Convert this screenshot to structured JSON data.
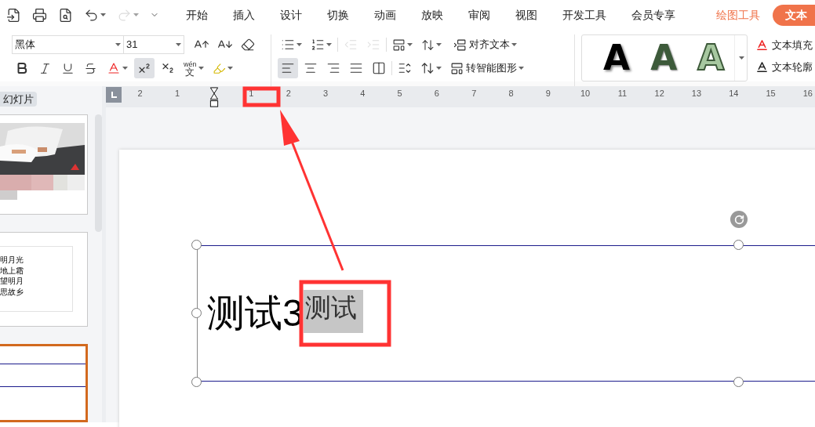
{
  "quick_access": [
    {
      "kind": "save",
      "disabled": false
    },
    {
      "kind": "print",
      "disabled": false
    },
    {
      "kind": "preview",
      "disabled": false
    },
    {
      "kind": "undo",
      "disabled": false
    },
    {
      "kind": "redo",
      "disabled": true
    },
    {
      "kind": "customize",
      "disabled": false
    }
  ],
  "tabs": [
    {
      "label": "开始",
      "kind": "normal",
      "selected": false
    },
    {
      "label": "插入",
      "kind": "normal",
      "selected": false
    },
    {
      "label": "设计",
      "kind": "normal",
      "selected": false
    },
    {
      "label": "切换",
      "kind": "normal",
      "selected": false
    },
    {
      "label": "动画",
      "kind": "normal",
      "selected": false
    },
    {
      "label": "放映",
      "kind": "normal",
      "selected": false
    },
    {
      "label": "审阅",
      "kind": "normal",
      "selected": false
    },
    {
      "label": "视图",
      "kind": "normal",
      "selected": false
    },
    {
      "label": "开发工具",
      "kind": "normal",
      "selected": false
    },
    {
      "label": "会员专享",
      "kind": "normal",
      "selected": false
    },
    {
      "label": "绘图工具",
      "kind": "context",
      "selected": false
    },
    {
      "label": "文本",
      "kind": "context",
      "selected": true
    }
  ],
  "font": {
    "name": "黑体",
    "size": "31"
  },
  "script_buttons": [
    {
      "kind": "superscript",
      "selected": true
    },
    {
      "kind": "subscript",
      "selected": false
    }
  ],
  "indent_buttons": [
    {
      "kind": "decrease",
      "disabled": true
    },
    {
      "kind": "increase",
      "disabled": true
    }
  ],
  "alignment": [
    {
      "kind": "left",
      "selected": true
    },
    {
      "kind": "center",
      "selected": false
    },
    {
      "kind": "right",
      "selected": false
    },
    {
      "kind": "justify",
      "selected": false
    },
    {
      "kind": "distributed",
      "selected": false
    }
  ],
  "pinyin": {
    "top": "wén",
    "bottom": "文"
  },
  "align_text_button": "对齐文本",
  "smartart_button": "转智能图形",
  "text_styles": [
    {
      "text": "A",
      "kind": "black"
    },
    {
      "text": "A",
      "kind": "green"
    },
    {
      "text": "A",
      "kind": "outline"
    }
  ],
  "text_fill": "文本填充",
  "text_outline": "文本轮廓",
  "ruler": {
    "left_labels": [
      "2",
      "1"
    ],
    "right_labels": [
      "1",
      "2",
      "3",
      "4",
      "5",
      "6",
      "7",
      "8",
      "9",
      "10",
      "11",
      "12",
      "13",
      "14",
      "15",
      "16"
    ]
  },
  "left_panel": {
    "tab": "幻灯片",
    "thumbnails": [
      {
        "kind": "picture",
        "selected": false
      },
      {
        "kind": "poem",
        "selected": false,
        "lines": [
          "明月光",
          "地上霜",
          "望明月",
          "思故乡"
        ]
      },
      {
        "kind": "lines",
        "selected": true
      }
    ]
  },
  "slide": {
    "runs": [
      {
        "text": "测试3",
        "selected": false,
        "superscript": false
      },
      {
        "text": "测试",
        "selected": true,
        "superscript": true
      }
    ]
  }
}
